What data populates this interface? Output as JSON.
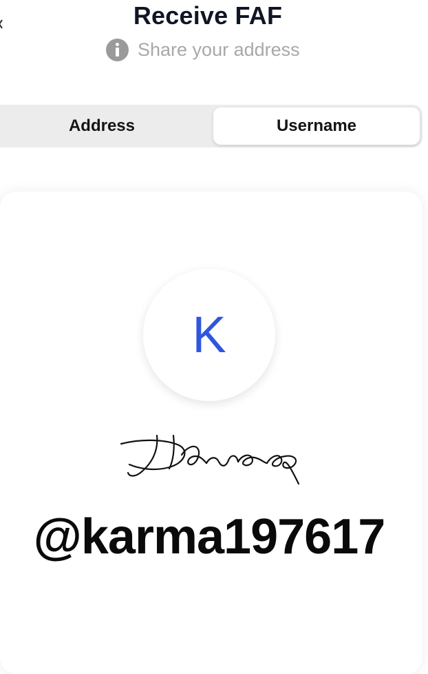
{
  "header": {
    "title": "Receive FAF",
    "subtitle": "Share your address",
    "info_icon": "info-icon"
  },
  "tabs": {
    "items": [
      {
        "label": "Address",
        "selected": false
      },
      {
        "label": "Username",
        "selected": true
      }
    ]
  },
  "card": {
    "avatar_letter": "K",
    "avatar_color": "#2f56de",
    "signature_icon": "signature-image",
    "username": "@karma197617"
  },
  "colors": {
    "title": "#0f1626",
    "subtitle": "#a8a8a8",
    "segment_bg": "#ececec",
    "accent": "#2f56de"
  }
}
